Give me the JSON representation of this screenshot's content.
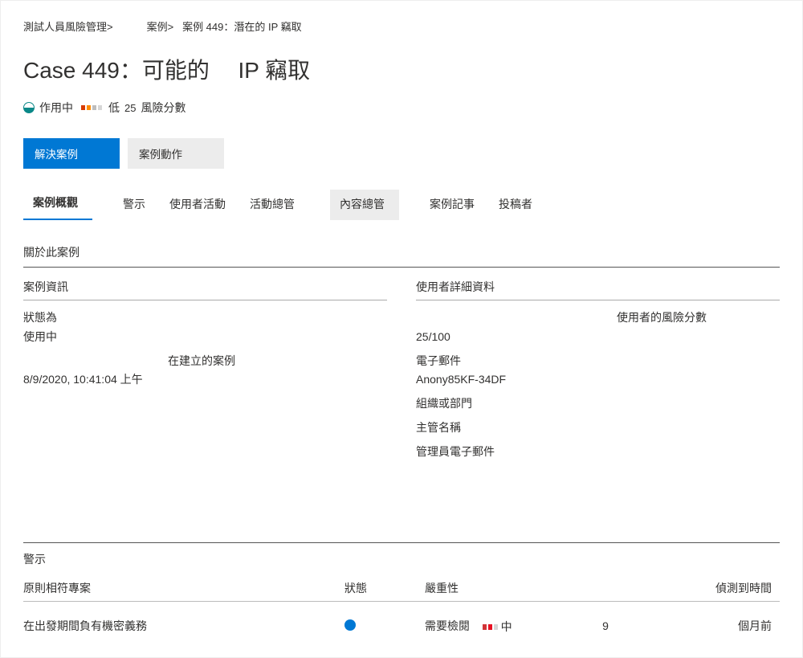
{
  "breadcrumb": {
    "root": "測試人員風險管理>",
    "mid": "案例>",
    "leaf": "案例 449：潛在的 IP 竊取"
  },
  "title": {
    "prefix": "Case 449：可能的",
    "suffix": "IP 竊取"
  },
  "status": {
    "active": "作用中",
    "level": "低",
    "score": "25",
    "score_label": "風險分數"
  },
  "actions": {
    "resolve": "解決案例",
    "case_action": "案例動作"
  },
  "tabs": {
    "overview": "案例概觀",
    "alerts": "警示",
    "user_activity": "使用者活動",
    "activity_exec": "活動總管",
    "content_exec": "內容總管",
    "case_notes": "案例記事",
    "contributors": "投稿者"
  },
  "about_label": "關於此案例",
  "case_info": {
    "heading": "案例資訊",
    "status_label": "狀態為",
    "status_value": "使用中",
    "created_label": "在建立的案例",
    "created_value": "8/9/2020, 10:41:04 上午"
  },
  "user_detail": {
    "heading": "使用者詳細資料",
    "risk_label": "使用者的風險分數",
    "risk_value": "25/100",
    "email_label": "電子郵件",
    "email_value": "Anony85KF-34DF",
    "org_label": "組織或部門",
    "manager_label": "主管名稱",
    "admin_email_label": "管理員電子郵件"
  },
  "alerts_section": {
    "heading": "警示",
    "col_policy": "原則相符專案",
    "col_status": "狀態",
    "col_severity": "嚴重性",
    "col_time": "偵測到時間",
    "row": {
      "policy": "在出發期間負有機密義務",
      "review": "需要檢閱",
      "sev_text": "中",
      "num": "9",
      "time": "個月前"
    }
  }
}
